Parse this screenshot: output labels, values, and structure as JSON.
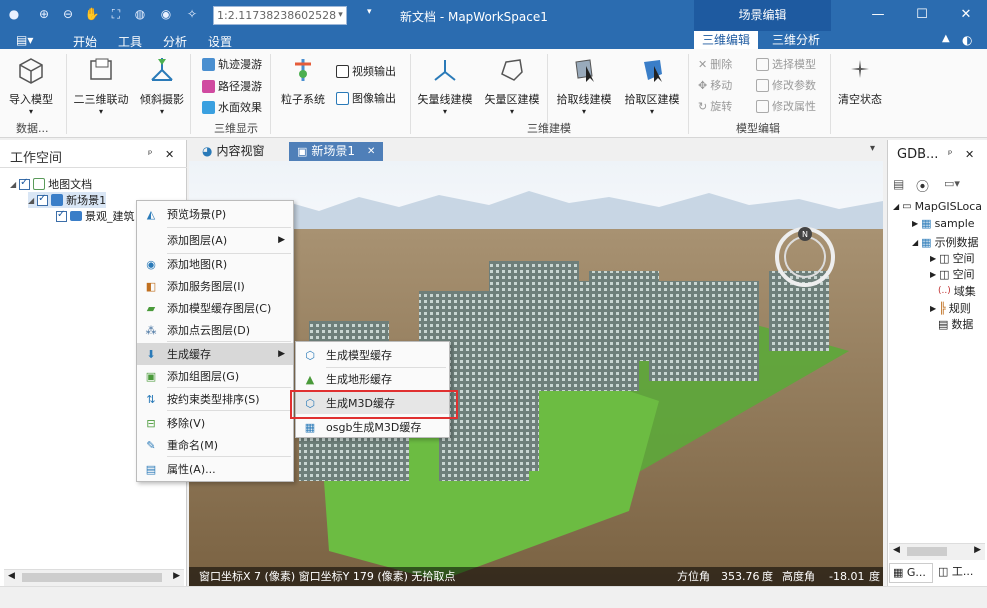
{
  "titlebar": {
    "scale": "1:2.11738238602528",
    "title": "新文档 - MapWorkSpace1",
    "context_label": "场景编辑",
    "min": "—",
    "max": "☐",
    "close": "✕"
  },
  "menubar": {
    "file_icon": "▤▾",
    "items": [
      "开始",
      "工具",
      "分析",
      "设置"
    ],
    "ribbon_tabs": [
      "三维编辑",
      "三维分析"
    ],
    "up": "▲"
  },
  "ribbon": {
    "import_model": "导入模型",
    "linkage": "二三维联动",
    "oblique": "倾斜摄影",
    "track_roam": "轨迹漫游",
    "path_roam": "路径漫游",
    "water": "水面效果",
    "particle": "粒子系统",
    "video_out": "视频输出",
    "image_out": "图像输出",
    "vec_line": "矢量线建模",
    "vec_area": "矢量区建模",
    "pick_line": "拾取线建模",
    "pick_area": "拾取区建模",
    "delete": "删除",
    "move": "移动",
    "rotate": "旋转",
    "select_model": "选择模型",
    "modify_param": "修改参数",
    "modify_attr": "修改属性",
    "clear_state": "清空状态",
    "groups": [
      "数据...",
      "三维显示",
      "三维建模",
      "模型编辑"
    ]
  },
  "workspace": {
    "title": "工作空间",
    "pin": "ᵖ",
    "close": "✕",
    "tree": [
      {
        "label": "地图文档"
      },
      {
        "label": "新场景1"
      },
      {
        "label": "景观_建筑"
      }
    ]
  },
  "doc_tabs": [
    {
      "label": "内容视窗"
    },
    {
      "label": "新场景1"
    }
  ],
  "doc_tab_close": "✕",
  "context_menu": {
    "items": [
      {
        "label": "预览场景(P)"
      },
      {
        "label": "添加图层(A)"
      },
      {
        "label": "添加地图(R)"
      },
      {
        "label": "添加服务图层(I)"
      },
      {
        "label": "添加模型缓存图层(C)"
      },
      {
        "label": "添加点云图层(D)"
      },
      {
        "label": "生成缓存"
      },
      {
        "label": "添加组图层(G)"
      },
      {
        "label": "按约束类型排序(S)"
      },
      {
        "label": "移除(V)"
      },
      {
        "label": "重命名(M)"
      },
      {
        "label": "属性(A)..."
      }
    ]
  },
  "submenu": {
    "items": [
      {
        "label": "生成模型缓存"
      },
      {
        "label": "生成地形缓存"
      },
      {
        "label": "生成M3D缓存"
      },
      {
        "label": "osgb生成M3D缓存"
      }
    ],
    "highlight_color": "#e03030"
  },
  "status": {
    "left": "窗口坐标X 7  (像素) 窗口坐标Y 179 (像素) 无拾取点",
    "azimuth_label": "方位角",
    "azimuth": "353.76",
    "deg": "度",
    "elev_label": "高度角",
    "elev": "-18.01",
    "deg2": "度"
  },
  "right_panel": {
    "title": "GDB...",
    "pin": "ᵖ",
    "close": "✕",
    "tree": [
      {
        "label": "MapGISLoca"
      },
      {
        "label": "sample"
      },
      {
        "label": "示例数据"
      },
      {
        "label": "空间"
      },
      {
        "label": "空间"
      },
      {
        "label": "域集"
      },
      {
        "label": "规则"
      },
      {
        "label": "数据"
      }
    ],
    "bottom_tabs": [
      "G...",
      "工..."
    ]
  }
}
